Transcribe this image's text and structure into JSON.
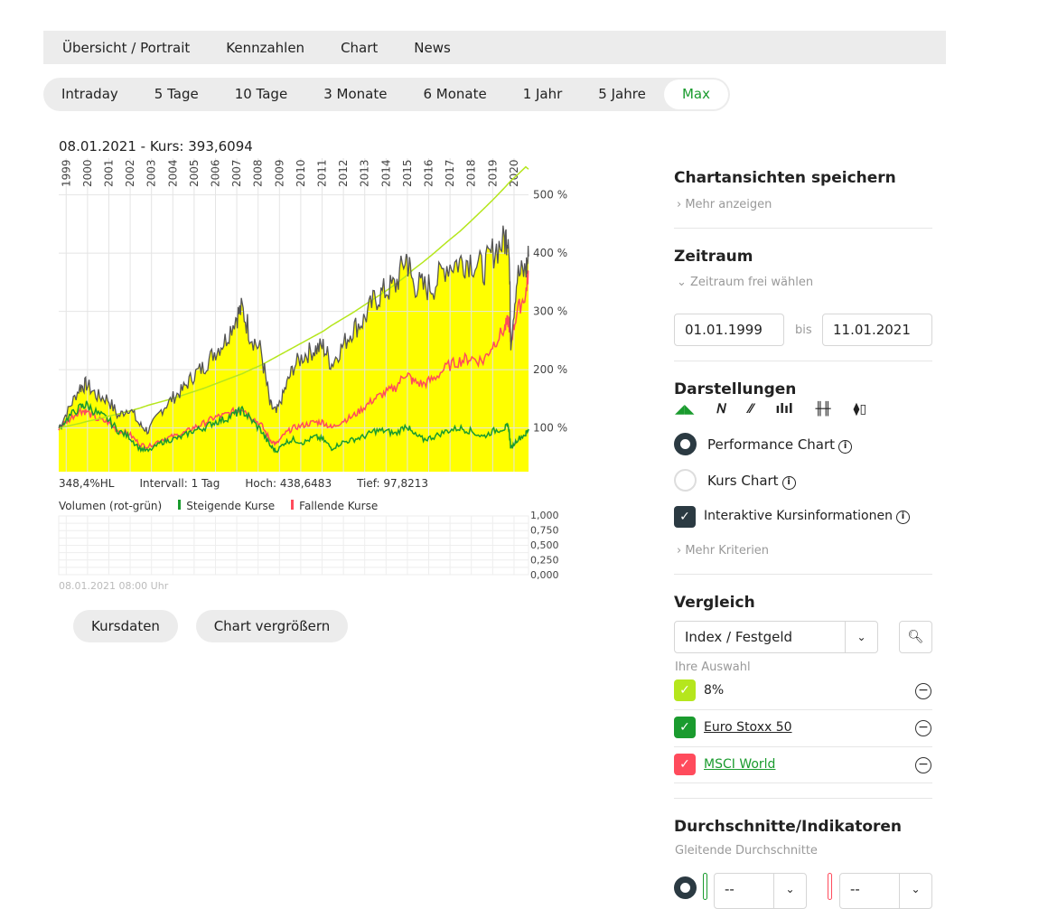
{
  "topnav": [
    "Übersicht / Portrait",
    "Kennzahlen",
    "Chart",
    "News"
  ],
  "ranges": [
    "Intraday",
    "5 Tage",
    "10 Tage",
    "3 Monate",
    "6 Monate",
    "1 Jahr",
    "5 Jahre",
    "Max"
  ],
  "active_range": "Max",
  "chart_header": "08.01.2021  - Kurs: 393,6094",
  "stats": {
    "hl": "348,4%HL",
    "interval": "Intervall: 1 Tag",
    "high": "Hoch: 438,6483",
    "low": "Tief: 97,8213"
  },
  "volume": {
    "label": "Volumen (rot-grün)",
    "up": "Steigende Kurse",
    "down": "Fallende Kurse",
    "ticks": [
      "1,000",
      "0,750",
      "0,500",
      "0,250",
      "0,000"
    ],
    "timestamp": "08.01.2021 08:00 Uhr"
  },
  "buttons": {
    "kursdaten": "Kursdaten",
    "enlarge": "Chart vergrößern"
  },
  "chart_data": {
    "type": "area",
    "x_ticks": [
      "1999",
      "2000",
      "2001",
      "2002",
      "2003",
      "2004",
      "2005",
      "2006",
      "2007",
      "2008",
      "2009",
      "2010",
      "2011",
      "2012",
      "2013",
      "2014",
      "2015",
      "2016",
      "2017",
      "2018",
      "2019",
      "2020"
    ],
    "y_ticks": [
      "100 %",
      "200 %",
      "300 %",
      "400 %",
      "500 %"
    ],
    "ylim": [
      25,
      563
    ],
    "xlim": [
      1999.0,
      2021.03
    ],
    "x": [
      1999.0,
      1999.5,
      2000.0,
      2000.3,
      2000.8,
      2001.3,
      2001.8,
      2002.3,
      2002.8,
      2003.2,
      2003.8,
      2004.3,
      2004.8,
      2005.3,
      2005.8,
      2006.3,
      2006.8,
      2007.3,
      2007.6,
      2008.0,
      2008.5,
      2008.9,
      2009.2,
      2009.6,
      2010.0,
      2010.5,
      2011.0,
      2011.4,
      2011.8,
      2012.3,
      2012.8,
      2013.3,
      2013.8,
      2014.3,
      2014.8,
      2015.3,
      2015.6,
      2016.1,
      2016.6,
      2017.2,
      2017.8,
      2018.3,
      2018.9,
      2019.4,
      2019.9,
      2020.1,
      2020.2,
      2020.5,
      2020.9,
      2021.03
    ],
    "series": [
      {
        "color": "#555555",
        "fill": "#ffff00",
        "values": [
          100,
          135,
          170,
          175,
          155,
          150,
          120,
          135,
          105,
          95,
          130,
          150,
          165,
          190,
          205,
          230,
          250,
          290,
          305,
          260,
          230,
          140,
          125,
          165,
          205,
          225,
          235,
          240,
          210,
          240,
          270,
          285,
          320,
          335,
          345,
          395,
          350,
          340,
          345,
          380,
          385,
          390,
          370,
          405,
          420,
          438,
          250,
          360,
          370,
          394
        ]
      },
      {
        "color": "#b5e61d",
        "values": [
          100,
          104,
          108,
          111,
          115,
          120,
          124,
          129,
          134,
          139,
          145,
          150,
          156,
          162,
          168,
          175,
          182,
          189,
          193,
          200,
          208,
          216,
          222,
          230,
          238,
          248,
          258,
          266,
          276,
          287,
          298,
          310,
          322,
          334,
          347,
          361,
          371,
          385,
          400,
          419,
          437,
          454,
          475,
          493,
          512,
          520,
          524,
          534,
          548,
          544
        ]
      },
      {
        "color": "#1a9b2e",
        "values": [
          100,
          120,
          135,
          140,
          125,
          115,
          95,
          85,
          65,
          60,
          75,
          80,
          85,
          95,
          100,
          110,
          115,
          125,
          130,
          115,
          95,
          70,
          60,
          75,
          80,
          75,
          85,
          80,
          65,
          75,
          80,
          85,
          95,
          95,
          90,
          105,
          90,
          80,
          85,
          95,
          100,
          95,
          85,
          95,
          100,
          102,
          65,
          80,
          90,
          98
        ]
      },
      {
        "color": "#ff4b5c",
        "values": [
          100,
          115,
          130,
          128,
          115,
          110,
          95,
          90,
          72,
          68,
          80,
          85,
          90,
          100,
          108,
          118,
          122,
          130,
          135,
          120,
          105,
          80,
          72,
          90,
          100,
          105,
          110,
          110,
          100,
          112,
          120,
          135,
          150,
          160,
          170,
          195,
          180,
          175,
          185,
          205,
          215,
          220,
          215,
          245,
          270,
          285,
          250,
          300,
          330,
          370
        ]
      }
    ]
  },
  "side": {
    "save_title": "Chartansichten speichern",
    "more": "Mehr anzeigen",
    "period_title": "Zeitraum",
    "period_free": "Zeitraum frei wählen",
    "from": "01.01.1999",
    "bis": "bis",
    "to": "11.01.2021",
    "display_title": "Darstellungen",
    "perf": "Performance Chart",
    "kurs": "Kurs Chart",
    "interactive": "Interaktive Kursinformationen",
    "more_criteria": "Mehr Kriterien",
    "compare_title": "Vergleich",
    "compare_select": "Index / Festgeld",
    "your_selection": "Ihre Auswahl",
    "selection": [
      {
        "label": "8%",
        "color": "#b5e61d"
      },
      {
        "label": "Euro Stoxx 50",
        "color": "#1a9b2e"
      },
      {
        "label": "MSCI World",
        "color": "#ff4b5c"
      }
    ],
    "ind_title": "Durchschnitte/Indikatoren",
    "ma": "Gleitende Durchschnitte",
    "ma1": "--",
    "ma2": "--"
  }
}
